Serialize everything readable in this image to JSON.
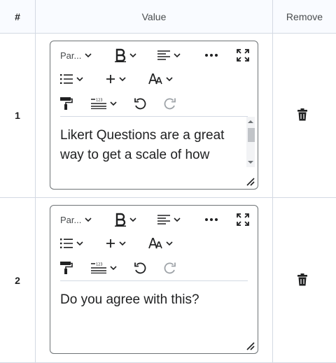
{
  "table": {
    "headers": {
      "number": "#",
      "value": "Value",
      "remove": "Remove"
    },
    "rows": [
      {
        "number": "1",
        "text": "Likert Questions are a great way to get a scale of how",
        "toolbar": {
          "paragraph_label": "Par..."
        }
      },
      {
        "number": "2",
        "text": "Do you agree with this?",
        "toolbar": {
          "paragraph_label": "Par..."
        }
      }
    ]
  },
  "icons": {
    "bold": "bold-icon",
    "align": "align-icon",
    "more": "more-icon",
    "fullscreen": "fullscreen-icon",
    "list": "list-icon",
    "insert": "plus-icon",
    "font": "font-size-icon",
    "format_painter": "format-painter-icon",
    "line_numbers": "line-numbers-icon",
    "undo": "undo-icon",
    "redo": "redo-icon",
    "delete": "trash-icon"
  },
  "colors": {
    "header_bg": "#f9fbff",
    "border": "#d3d9e3",
    "text": "#202122",
    "disabled": "#9ea3a8"
  }
}
